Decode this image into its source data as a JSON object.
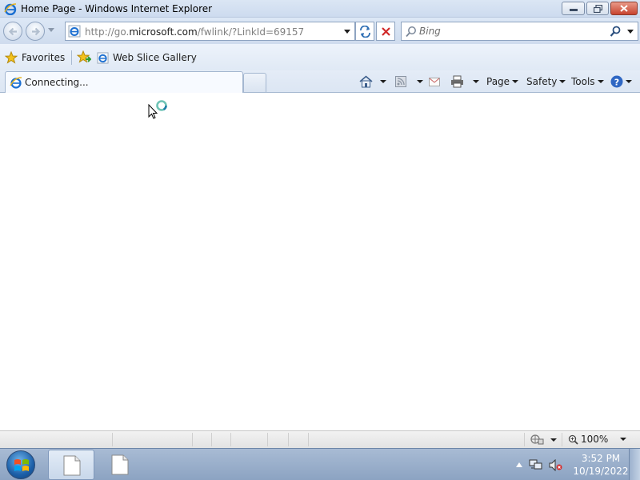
{
  "window": {
    "title": "Home Page - Windows Internet Explorer",
    "controls": [
      "minimize-icon",
      "maximize-icon",
      "close-icon"
    ]
  },
  "navigation": {
    "address_url_prefix": "http://go.",
    "address_url_domain": "microsoft.com",
    "address_url_path": "/fwlink/?LinkId=69157",
    "search_placeholder": "Bing"
  },
  "favorites_bar": {
    "favorites_label": "Favorites",
    "links": [
      {
        "label": "Web Slice Gallery",
        "icon": "ie-page-icon"
      }
    ]
  },
  "tabs": [
    {
      "label": "Connecting...",
      "active": true,
      "icon": "ie-loading-icon"
    }
  ],
  "command_bar": {
    "page_label": "Page",
    "safety_label": "Safety",
    "tools_label": "Tools",
    "icons": [
      "home-icon",
      "feeds-icon",
      "read-mail-icon",
      "print-icon",
      "help-icon"
    ]
  },
  "status_bar": {
    "zoom": "100%"
  },
  "taskbar": {
    "items": [
      {
        "icon": "document-icon",
        "active": true
      },
      {
        "icon": "document-icon",
        "active": false
      }
    ],
    "clock_time": "3:52 PM",
    "clock_date": "10/19/2022"
  },
  "colors": {
    "ie_blue": "#1b6fd1",
    "stop_red": "#d12a2a",
    "accent_frame": "#cfdcee"
  }
}
